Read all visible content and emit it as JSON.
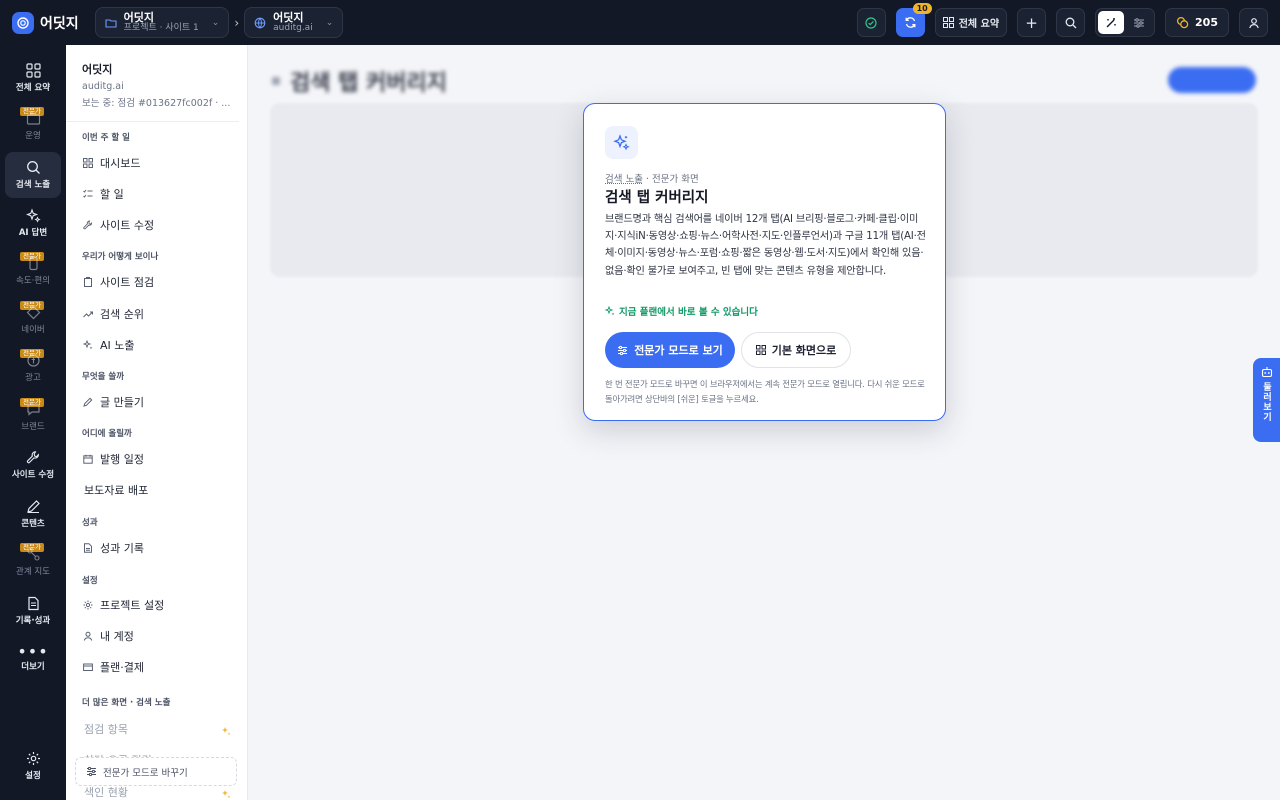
{
  "app": {
    "name": "어딧지",
    "accent": "#3b6df2",
    "dark_bg": "#121826"
  },
  "topbar": {
    "project_crumb": {
      "title": "어딧지",
      "subtitle": "프로젝트 · 사이트 1"
    },
    "site_crumb": {
      "title": "어딧지",
      "subtitle": "auditg.ai"
    },
    "sync_badge": "10",
    "overview_label": "전체 요약",
    "credits": "205"
  },
  "rail": {
    "items": [
      {
        "label": "전체 요약",
        "icon": "grid-icon"
      },
      {
        "label": "운영",
        "icon": "briefcase-icon",
        "tag": "전문가"
      },
      {
        "label": "검색 노출",
        "icon": "search-icon"
      },
      {
        "label": "AI 답변",
        "icon": "sparkles-icon"
      },
      {
        "label": "속도·편의",
        "icon": "phone-icon",
        "tag": "전문가"
      },
      {
        "label": "네이버",
        "icon": "naver-icon",
        "tag": "전문가"
      },
      {
        "label": "광고",
        "icon": "ad-icon",
        "tag": "전문가"
      },
      {
        "label": "브랜드",
        "icon": "chat-icon",
        "tag": "전문가"
      },
      {
        "label": "사이트 수정",
        "icon": "wrench-icon"
      },
      {
        "label": "콘텐츠",
        "icon": "pen-icon"
      },
      {
        "label": "관계 지도",
        "icon": "map-icon",
        "tag": "전문가"
      },
      {
        "label": "기록·성과",
        "icon": "document-icon"
      },
      {
        "label": "더보기",
        "icon": "more-icon"
      },
      {
        "label": "설정",
        "icon": "gear-icon"
      }
    ]
  },
  "sidebar": {
    "project_name": "어딧지",
    "project_domain": "auditg.ai",
    "viewing": "보는 중: 점검 #013627fc002f · ...",
    "sections": {
      "this_week": "이번 주 할 일",
      "how_seen": "우리가 어떻게 보이나",
      "what_write": "무엇을 쓸까",
      "where_post": "어디에 올릴까",
      "results": "성과",
      "settings": "설정",
      "more": "더 많은 화면 · 검색 노출"
    },
    "items": {
      "dashboard": "대시보드",
      "todo": "할 일",
      "site_fix": "사이트 수정",
      "site_check": "사이트 점검",
      "search_rank": "검색 순위",
      "ai_exposure": "AI 노출",
      "write": "글 만들기",
      "schedule": "발행 일정",
      "press": "보도자료 배포",
      "records": "성과 기록",
      "project_settings": "프로젝트 설정",
      "account": "내 계정",
      "plan": "플랜·결제",
      "check_items": "점검 항목",
      "block_errors": "차단·오류 점검",
      "index_status": "색인 현황"
    },
    "expert_toggle": "전문가 모드로 바꾸기"
  },
  "main": {
    "title": "검색 탭 커버리지"
  },
  "modal": {
    "crumb_a": "검색 노출",
    "crumb_b": " · 전문가 화면",
    "title": "검색 탭 커버리지",
    "description": "브랜드명과 핵심 검색어를 네이버 12개 탭(AI 브리핑·블로그·카페·클립·이미지·지식iN·동영상·쇼핑·뉴스·어학사전·지도·인플루언서)과 구글 11개 탭(AI·전체·이미지·동영상·뉴스·포럼·쇼핑·짧은 동영상·웹·도서·지도)에서 확인해 있음·없음·확인 불가로 보여주고, 빈 탭에 맞는 콘텐츠 유형을 제안합니다.",
    "available": "지금 플랜에서 바로 볼 수 있습니다",
    "available_color": "#0f9a67",
    "primary_button": "전문가 모드로 보기",
    "secondary_button": "기본 화면으로",
    "note": "한 번 전문가 모드로 바꾸면 이 브라우저에서는 계속 전문가 모드로 열립니다. 다시 쉬운 모드로 돌아가려면 상단바의 [쉬운] 토글을 누르세요."
  },
  "float_tab": {
    "label": "둘러보기"
  }
}
